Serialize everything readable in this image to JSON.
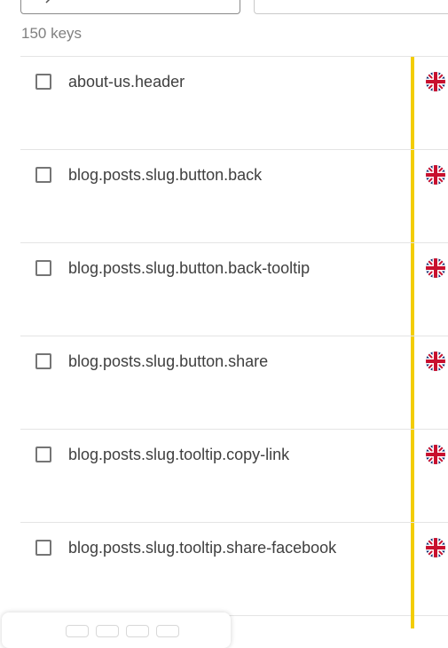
{
  "header": {
    "search_icon": "search-icon",
    "key_count": "150 keys"
  },
  "colors": {
    "state_bar": "#f3cd05",
    "divider": "#e4e4e4"
  },
  "keys": [
    {
      "name": "about-us.header",
      "flag": "uk-flag-icon"
    },
    {
      "name": "blog.posts.slug.button.back",
      "flag": "uk-flag-icon"
    },
    {
      "name": "blog.posts.slug.button.back-tooltip",
      "flag": "uk-flag-icon"
    },
    {
      "name": "blog.posts.slug.button.share",
      "flag": "uk-flag-icon"
    },
    {
      "name": "blog.posts.slug.tooltip.copy-link",
      "flag": "uk-flag-icon"
    },
    {
      "name": "blog.posts.slug.tooltip.share-facebook",
      "flag": "uk-flag-icon"
    }
  ]
}
